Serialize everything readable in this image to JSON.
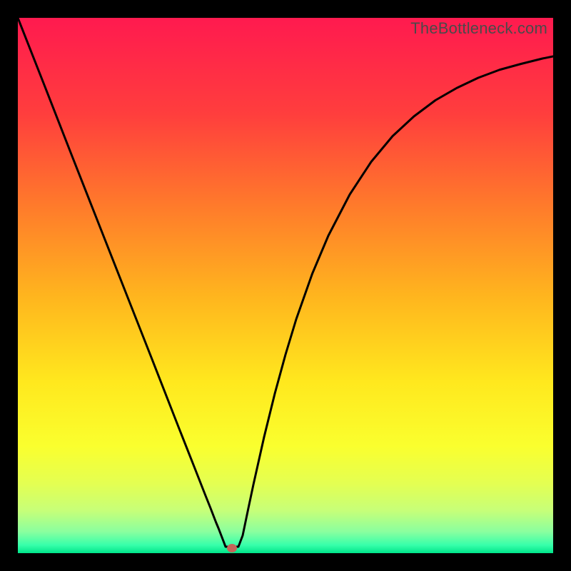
{
  "watermark": "TheBottleneck.com",
  "chart_data": {
    "type": "line",
    "title": "",
    "xlabel": "",
    "ylabel": "",
    "xlim": [
      0,
      1
    ],
    "ylim": [
      0,
      1
    ],
    "x": [
      0.0,
      0.05,
      0.1,
      0.15,
      0.2,
      0.25,
      0.3,
      0.33,
      0.35,
      0.36,
      0.37,
      0.375,
      0.38,
      0.385,
      0.388,
      0.412,
      0.42,
      0.43,
      0.44,
      0.46,
      0.48,
      0.5,
      0.52,
      0.55,
      0.58,
      0.62,
      0.66,
      0.7,
      0.74,
      0.78,
      0.82,
      0.86,
      0.9,
      0.94,
      0.98,
      1.0
    ],
    "values": [
      1.0,
      0.873,
      0.745,
      0.618,
      0.491,
      0.364,
      0.236,
      0.16,
      0.109,
      0.084,
      0.058,
      0.046,
      0.033,
      0.02,
      0.012,
      0.012,
      0.033,
      0.081,
      0.128,
      0.217,
      0.298,
      0.371,
      0.437,
      0.522,
      0.593,
      0.67,
      0.731,
      0.779,
      0.816,
      0.846,
      0.869,
      0.888,
      0.903,
      0.914,
      0.924,
      0.928
    ],
    "min_marker": {
      "x": 0.4,
      "y": 0.01
    },
    "background_gradient": {
      "stops": [
        {
          "pos": 0.0,
          "color": "#ff1a4f"
        },
        {
          "pos": 0.18,
          "color": "#ff3e3d"
        },
        {
          "pos": 0.35,
          "color": "#ff7a2b"
        },
        {
          "pos": 0.52,
          "color": "#ffb51e"
        },
        {
          "pos": 0.68,
          "color": "#ffe81e"
        },
        {
          "pos": 0.8,
          "color": "#faff2e"
        },
        {
          "pos": 0.87,
          "color": "#e4ff52"
        },
        {
          "pos": 0.92,
          "color": "#c7ff78"
        },
        {
          "pos": 0.96,
          "color": "#8aff9f"
        },
        {
          "pos": 0.985,
          "color": "#37ffaa"
        },
        {
          "pos": 1.0,
          "color": "#00e58a"
        }
      ]
    }
  }
}
